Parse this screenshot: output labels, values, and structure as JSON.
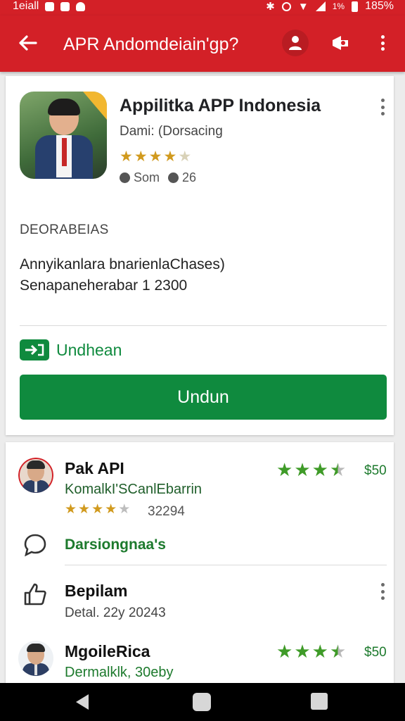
{
  "status_bar": {
    "carrier": "1eiall",
    "battery": "185%",
    "percent_small": "1%"
  },
  "app_bar": {
    "title": "APR Andomdeiain'gp?",
    "icons": [
      "back-arrow-icon",
      "person-icon",
      "share-icon",
      "more-vert-icon"
    ]
  },
  "app": {
    "title": "Appilitka APP Indonesia",
    "developer": "Dami: (Dorsacing",
    "rating": 4,
    "meta_size": "Som",
    "meta_count": "26"
  },
  "description": {
    "heading": "DEORABEIAS",
    "line1": "Annyikanlara bnarienlaChases)",
    "line2": "Senapaneherabar 1 2300"
  },
  "install": {
    "label": "Undhean",
    "button": "Undun"
  },
  "reviews": [
    {
      "name": "Pak API",
      "subtitle": "KomalkI'SCanlEbarrin",
      "stars": 4,
      "count": "32294",
      "score_stars": 3.5,
      "score": "$50"
    },
    {
      "name": "MgoileRica",
      "subtitle": "Dermalklk, 30eby",
      "score_stars": 3.5,
      "score": "$50"
    }
  ],
  "links": {
    "discussion": "Darsiongnaa's"
  },
  "entry": {
    "title": "Bepilam",
    "date": "Detal. 22y 20243"
  },
  "colors": {
    "primary": "#d32027",
    "accent": "#0f8a3e",
    "star": "#d19a1e",
    "green_star": "#3f9b28"
  }
}
